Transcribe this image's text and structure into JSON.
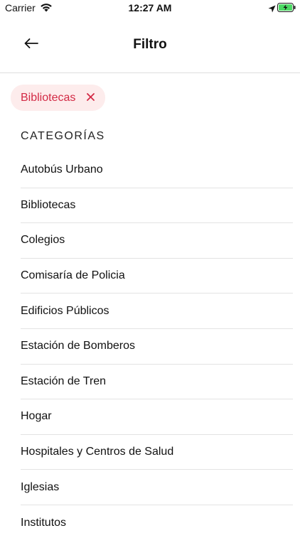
{
  "status_bar": {
    "carrier": "Carrier",
    "time": "12:27 AM",
    "battery_color": "#4cd964"
  },
  "header": {
    "title": "Filtro",
    "back_icon": "arrow-left-icon"
  },
  "active_filter": {
    "label": "Bibliotecas",
    "remove_icon": "close-icon",
    "color": "#d32a45",
    "background": "#fdecec"
  },
  "categories": {
    "title": "CATEGORÍAS",
    "items": [
      {
        "label": "Autobús Urbano"
      },
      {
        "label": "Bibliotecas"
      },
      {
        "label": "Colegios"
      },
      {
        "label": "Comisaría de Policia"
      },
      {
        "label": "Edificios Públicos"
      },
      {
        "label": "Estación de Bomberos"
      },
      {
        "label": "Estación de Tren"
      },
      {
        "label": "Hogar"
      },
      {
        "label": "Hospitales y Centros de Salud"
      },
      {
        "label": "Iglesias"
      },
      {
        "label": "Institutos"
      }
    ]
  }
}
